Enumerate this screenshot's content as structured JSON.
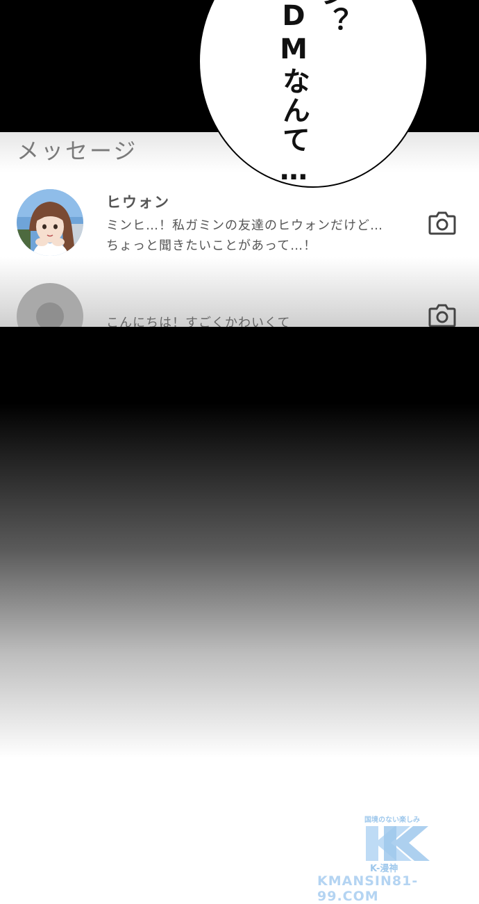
{
  "speech_bubble": {
    "line_right": "ン？",
    "line_left": "DMなんて…"
  },
  "messages_screen": {
    "title": "メッセージ",
    "items": [
      {
        "name": "ヒウォン",
        "line1": "ミンヒ…！私ガミンの友達のヒウォンだけど…",
        "line2": "ちょっと聞きたいことがあって…！",
        "avatar": "girl-avatar-photo",
        "icon": "camera-icon"
      },
      {
        "name": "",
        "line1": "こんにちは！すごくかわいくて",
        "avatar": "default-avatar",
        "icon": "camera-icon"
      }
    ]
  },
  "watermark": {
    "top_text": "国境のない楽しみ",
    "logo": "K",
    "sub_text": "K-漫神",
    "url": "KMANSIN81-99.COM"
  },
  "colors": {
    "text_gray": "#555555",
    "watermark_blue": "#7fb6e6"
  }
}
